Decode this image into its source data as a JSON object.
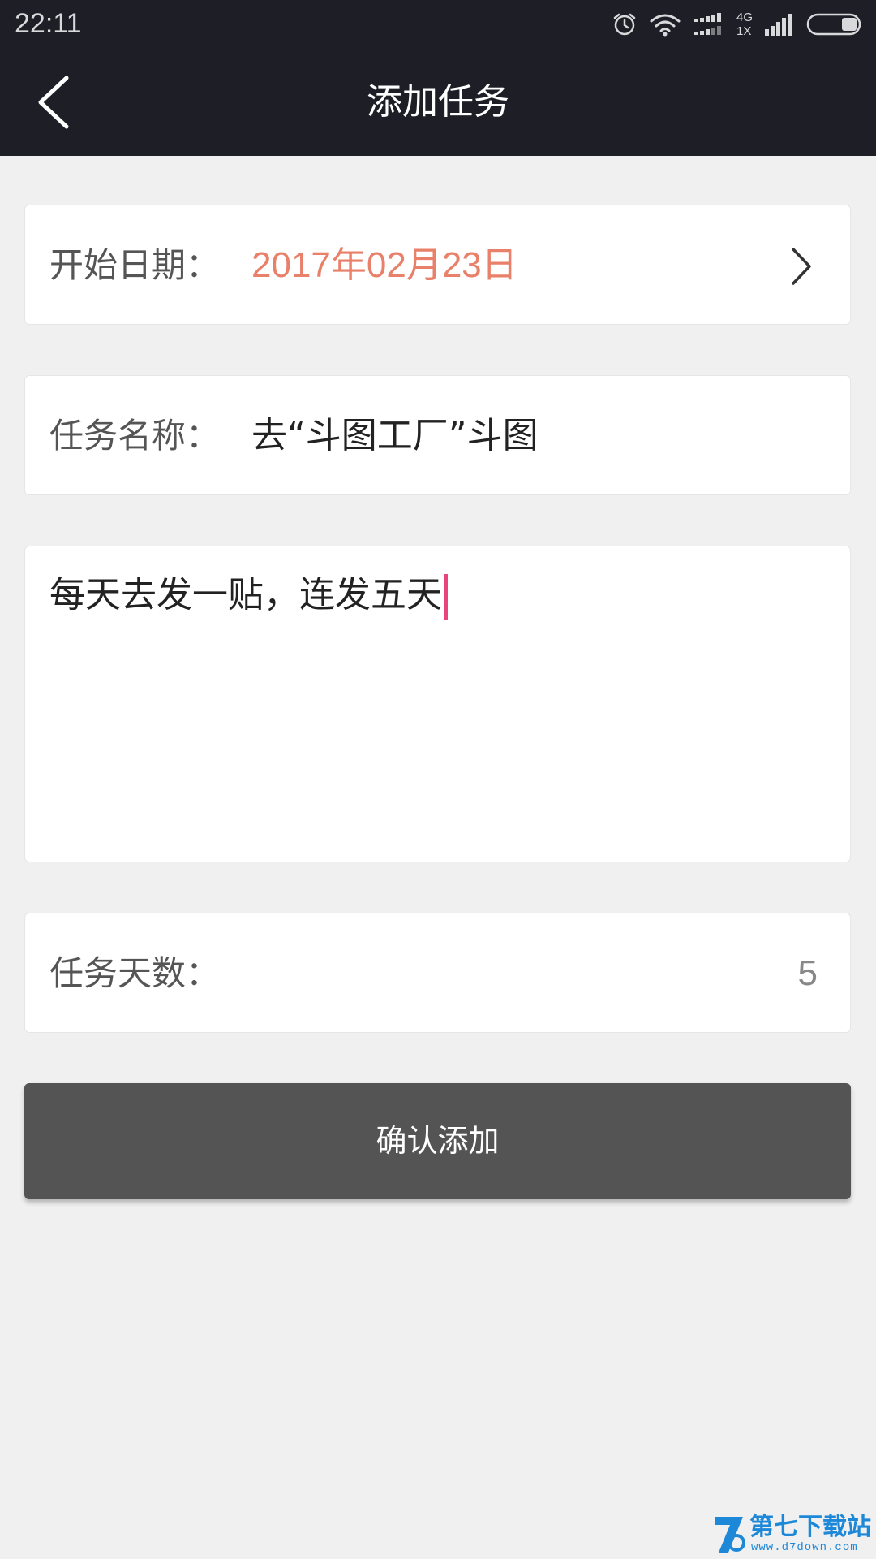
{
  "status_bar": {
    "time": "22:11",
    "network_top": "4G",
    "network_bottom": "1X",
    "icons": [
      "alarm-icon",
      "wifi-icon",
      "data-arrows-icon",
      "signal-icon",
      "battery-icon"
    ]
  },
  "header": {
    "title": "添加任务",
    "back_icon": "back-arrow-icon"
  },
  "start_date": {
    "label": "开始日期：",
    "value": "2017年02月23日",
    "value_color": "#e8806a"
  },
  "task_name": {
    "label": "任务名称：",
    "value": "去“斗图工厂”斗图"
  },
  "description": {
    "value": "每天去发一贴，连发五天"
  },
  "task_days": {
    "label": "任务天数：",
    "value": "5"
  },
  "confirm_button": {
    "label": "确认添加"
  },
  "watermark": {
    "title": "第七下载站",
    "url": "www.d7down.com"
  },
  "colors": {
    "header_bg": "#1e1f26",
    "page_bg": "#f0f0f0",
    "button_bg": "#545454",
    "cursor": "#e9457c"
  }
}
